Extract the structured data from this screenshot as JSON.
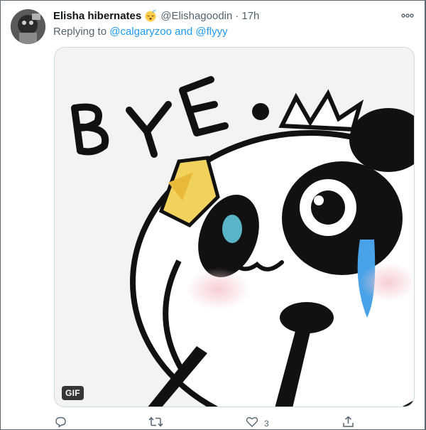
{
  "tweet": {
    "author_name": "Elisha hibernates",
    "author_emoji": "sleeping-face",
    "handle": "@Elishagoodin",
    "separator": "·",
    "time": "17h",
    "reply_prefix": "Replying to",
    "reply_to_1": "@calgaryzoo",
    "reply_conjunction": "and",
    "reply_to_2": "@flyyy",
    "media": {
      "type": "gif",
      "badge": "GIF",
      "caption_lettering": "BYE"
    },
    "actions": {
      "reply_count": "",
      "retweet_count": "",
      "like_count": "3",
      "share_count": ""
    }
  },
  "colors": {
    "link": "#1d9bf0",
    "secondary_text": "#536471",
    "primary_text": "#0f1419",
    "border": "#cfd9de"
  }
}
